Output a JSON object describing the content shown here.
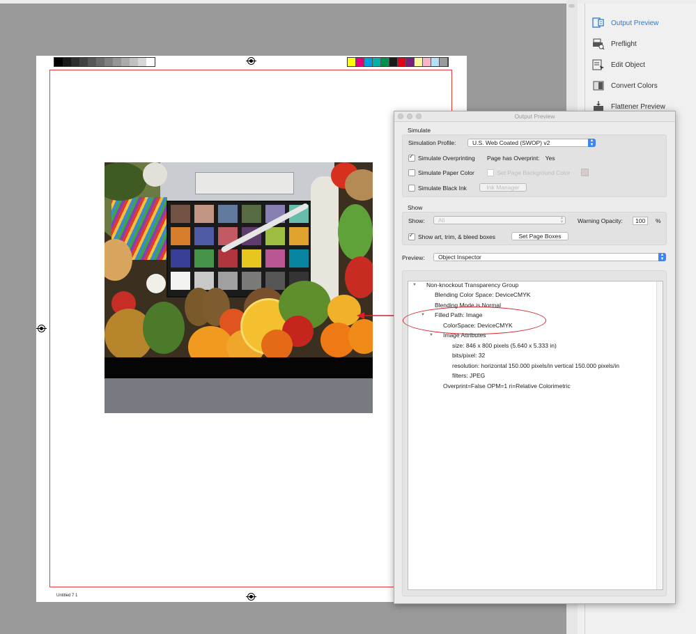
{
  "canvas": {
    "slug_text": "Untitled 7   1",
    "gray_ramp": [
      "#000000",
      "#1a1a1a",
      "#2e2e2e",
      "#424242",
      "#575757",
      "#6b6b6b",
      "#808080",
      "#969696",
      "#ababab",
      "#c0c0c0",
      "#d7d7d7",
      "#ffffff"
    ],
    "color_bar": [
      "#ffff00",
      "#e6007e",
      "#00a0e0",
      "#00b2a9",
      "#00914c",
      "#1a1a1a",
      "#e2001a",
      "#7a1f7a",
      "#fff799",
      "#f8b5c8",
      "#b3e0f5",
      "#9a9a9a"
    ]
  },
  "tools": {
    "items": [
      {
        "label": "Output Preview",
        "icon": "output-preview-icon"
      },
      {
        "label": "Preflight",
        "icon": "preflight-icon"
      },
      {
        "label": "Edit Object",
        "icon": "edit-object-icon"
      },
      {
        "label": "Convert Colors",
        "icon": "convert-colors-icon"
      },
      {
        "label": "Flattener Preview",
        "icon": "flattener-preview-icon"
      }
    ],
    "active_color": "#2a7ad5"
  },
  "dialog": {
    "title": "Output Preview",
    "simulate": {
      "heading": "Simulate",
      "profile_label": "Simulation Profile:",
      "profile_value": "U.S. Web Coated (SWOP) v2",
      "overprinting_label": "Simulate Overprinting",
      "overprinting_checked": true,
      "page_overprint_label": "Page has Overprint:",
      "page_overprint_value": "Yes",
      "paper_color_label": "Simulate Paper Color",
      "paper_color_checked": false,
      "page_bg_label": "Set Page Background Color",
      "black_ink_label": "Simulate Black Ink",
      "black_ink_checked": false,
      "ink_manager_label": "Ink Manager"
    },
    "show": {
      "heading": "Show",
      "show_label": "Show:",
      "show_value": "All",
      "warning_label": "Warning Opacity:",
      "warning_value": "100",
      "warning_unit": "%",
      "boxes_label": "Show art, trim, & bleed boxes",
      "boxes_checked": true,
      "set_boxes_label": "Set Page Boxes"
    },
    "preview": {
      "label": "Preview:",
      "value": "Object Inspector"
    },
    "tree": {
      "group": "Non-knockout Transparency Group",
      "blend_space": "Blending Color Space: DeviceCMYK",
      "blend_mode": "Blending Mode is Normal",
      "filled_path": "Filled Path: Image",
      "colorspace": "ColorSpace: DeviceCMYK",
      "image_attrs": "Image Attributes",
      "size": "size: 846 x 800 pixels (5.640 x 5.333 in)",
      "bits": "bits/pixel: 32",
      "resolution": "resolution: horizontal 150.000 pixels/in vertical 150.000 pixels/in",
      "filters": "filters: JPEG",
      "overprint": "Overprint=False OPM=1 ri=Relative Colorimetric"
    }
  },
  "annotation": {
    "color": "#d9212a"
  }
}
